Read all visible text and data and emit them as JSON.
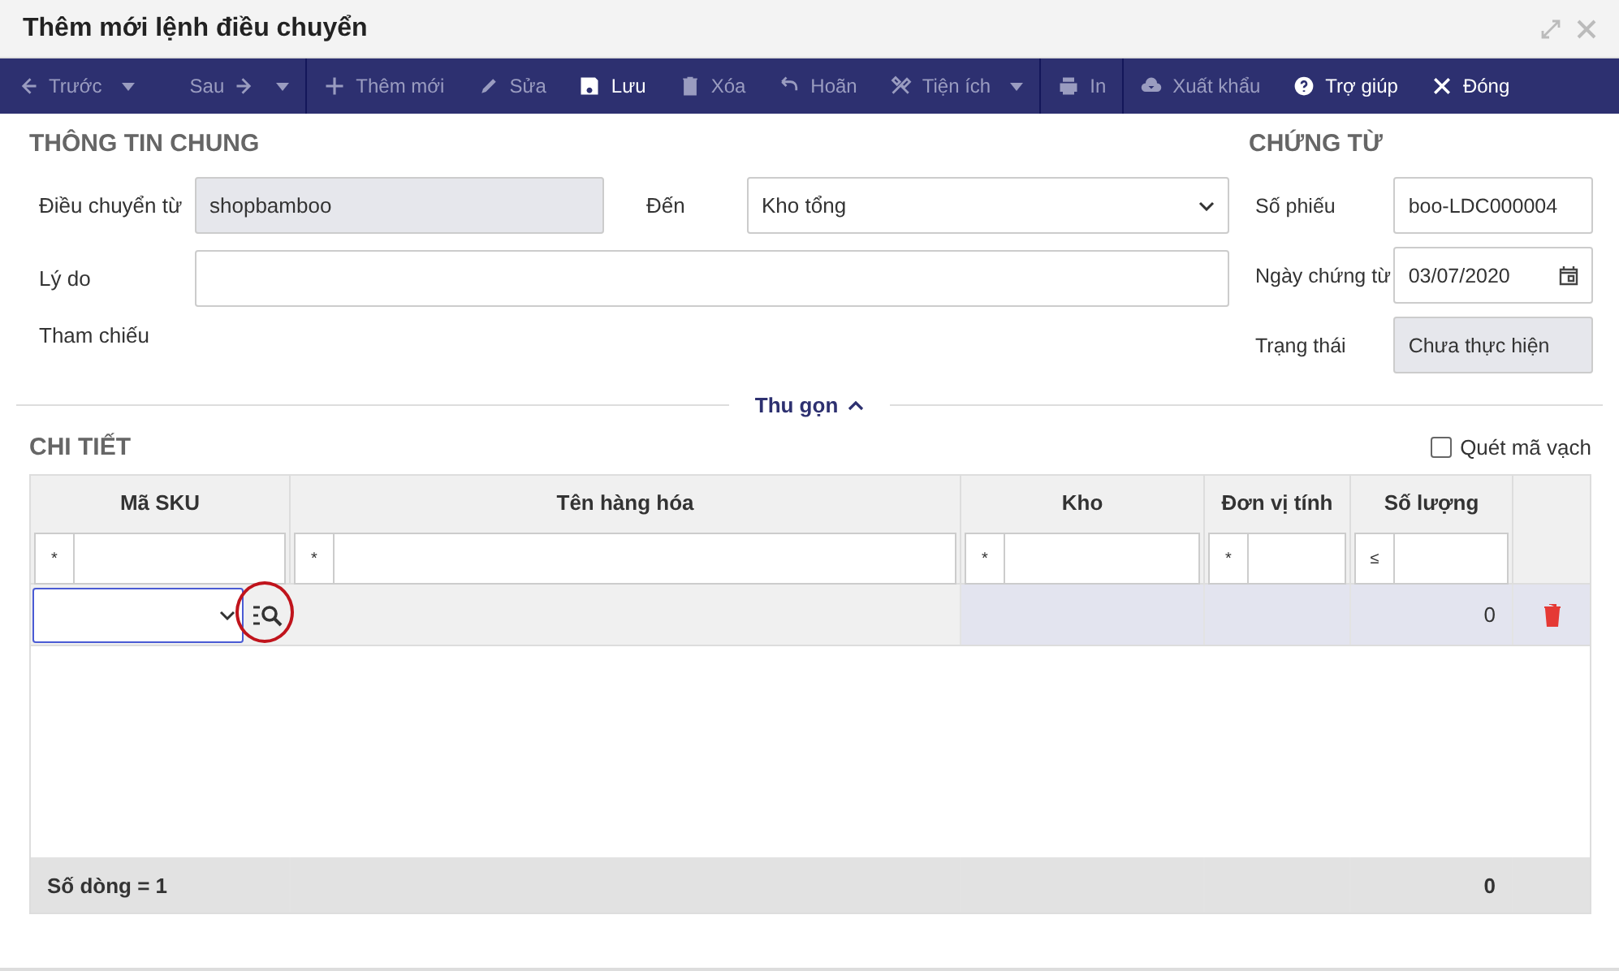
{
  "window": {
    "title": "Thêm mới lệnh điều chuyển"
  },
  "toolbar": [
    [
      {
        "label": "Trước",
        "disabled": true,
        "dropdown": true
      },
      {
        "label": "Sau",
        "disabled": true,
        "dropdown": true
      }
    ],
    [
      {
        "label": "Thêm mới",
        "disabled": true,
        "dropdown": false
      },
      {
        "label": "Sửa",
        "disabled": true,
        "dropdown": false
      },
      {
        "label": "Lưu",
        "disabled": false,
        "dropdown": false
      },
      {
        "label": "Xóa",
        "disabled": true,
        "dropdown": false
      },
      {
        "label": "Hoãn",
        "disabled": true,
        "dropdown": false
      },
      {
        "label": "Tiện ích",
        "disabled": true,
        "dropdown": true
      }
    ],
    [
      {
        "label": "In",
        "disabled": true,
        "dropdown": false
      }
    ],
    [
      {
        "label": "Xuất khẩu",
        "disabled": true,
        "dropdown": false
      },
      {
        "label": "Trợ giúp",
        "disabled": false,
        "dropdown": false
      },
      {
        "label": "Đóng",
        "disabled": false,
        "dropdown": false
      }
    ]
  ],
  "general": {
    "title": "THÔNG TIN CHUNG",
    "from_label": "Điều chuyển từ",
    "from_value": "shopbamboo",
    "to_label": "Đến",
    "to_value": "Kho tổng",
    "reason_label": "Lý do",
    "reference_label": "Tham chiếu"
  },
  "voucher": {
    "title": "CHỨNG TỪ",
    "fields": [
      {
        "label": "Số phiếu",
        "value": "boo-LDC000004",
        "kind": "text"
      },
      {
        "label": "Ngày chứng từ",
        "value": "03/07/2020",
        "kind": "date"
      },
      {
        "label": "Trạng thái",
        "value": "Chưa thực hiện",
        "kind": "readonly"
      }
    ]
  },
  "collapse": "Thu gọn",
  "detail": {
    "title": "CHI TIẾT",
    "barcode": {
      "label": "Quét mã vạch",
      "checked": false
    },
    "columns": [
      "Mã SKU",
      "Tên hàng hóa",
      "Kho",
      "Đơn vị tính",
      "Số lượng"
    ],
    "filters": [
      "*",
      "*",
      "*",
      "*",
      "≤"
    ],
    "rows": [
      {
        "quantity": "0"
      }
    ],
    "footer": {
      "count": "Số dòng = 1",
      "quantity": "0"
    }
  }
}
